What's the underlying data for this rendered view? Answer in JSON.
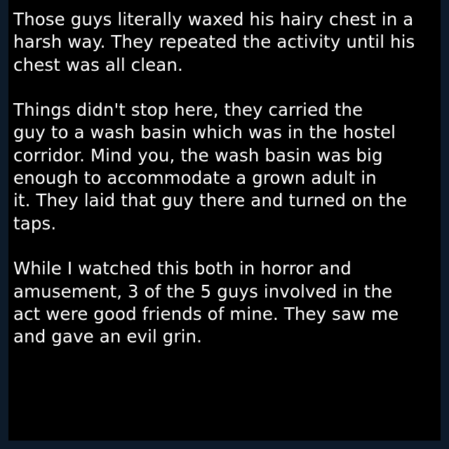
{
  "paragraphs": [
    {
      "lines": [
        "Those guys literally waxed his hairy chest in a",
        "harsh way. They repeated the activity until his",
        "chest was all clean."
      ]
    },
    {
      "lines": [
        "Things didn't stop here, they carried the",
        "guy to a wash basin which was in the hostel",
        "corridor. Mind you, the wash basin was big",
        "enough to accommodate a grown adult in",
        "it. They laid that guy there and turned on the",
        "taps."
      ]
    },
    {
      "lines": [
        "While I watched this both in horror and",
        "amusement, 3 of the 5 guys involved in the",
        "act were good friends of mine. They saw me",
        "and gave an evil grin."
      ]
    }
  ],
  "colors": {
    "background": "#000000",
    "text": "#ffffff",
    "border": "#0d1b2a"
  }
}
